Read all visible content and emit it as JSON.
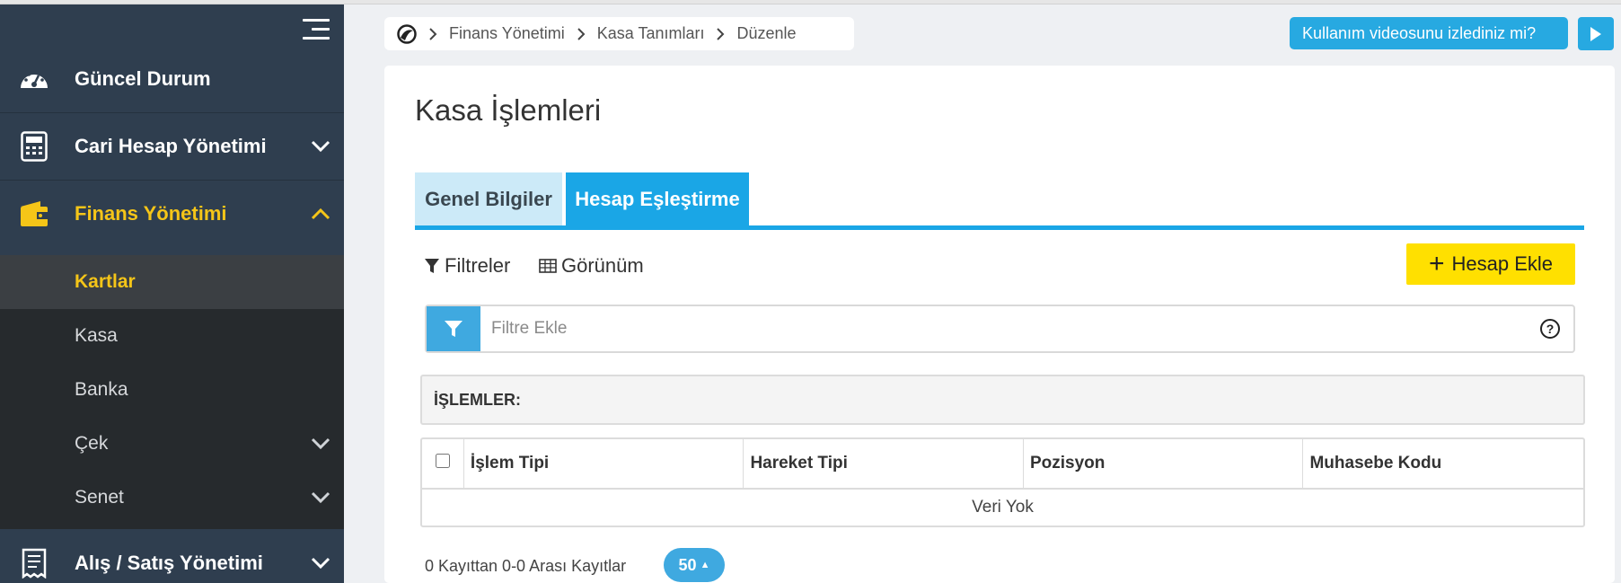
{
  "sidebar": {
    "items": [
      {
        "label": "Güncel Durum",
        "icon": "dashboard-gauge-icon"
      },
      {
        "label": "Cari Hesap Yönetimi",
        "icon": "calculator-icon"
      },
      {
        "label": "Finans Yönetimi",
        "icon": "wallet-icon"
      },
      {
        "label": "Alış / Satış Yönetimi",
        "icon": "receipt-icon"
      }
    ],
    "sub_items": [
      {
        "label": "Kartlar"
      },
      {
        "label": "Kasa"
      },
      {
        "label": "Banka"
      },
      {
        "label": "Çek"
      },
      {
        "label": "Senet"
      }
    ],
    "accent_color": "#f5c518"
  },
  "breadcrumb": {
    "items": [
      "Finans Yönetimi",
      "Kasa Tanımları",
      "Düzenle"
    ]
  },
  "help": {
    "video_label": "Kullanım videosunu izlediniz mi?"
  },
  "page": {
    "title": "Kasa İşlemleri",
    "tabs": [
      {
        "label": "Genel Bilgiler",
        "active": false
      },
      {
        "label": "Hesap Eşleştirme",
        "active": true
      }
    ]
  },
  "toolbar": {
    "filters_label": "Filtreler",
    "view_label": "Görünüm",
    "add_label": "Hesap Ekle"
  },
  "filter": {
    "placeholder": "Filtre Ekle"
  },
  "table": {
    "section_label": "İŞLEMLER:",
    "columns": [
      "İşlem Tipi",
      "Hareket Tipi",
      "Pozisyon",
      "Muhasebe Kodu"
    ],
    "empty_text": "Veri Yok"
  },
  "pager": {
    "summary": "0 Kayıttan 0-0 Arası Kayıtlar",
    "page_size": "50"
  },
  "colors": {
    "sidebar_bg": "#2f3e4f",
    "tab_active": "#1aa6e6",
    "add_button": "#ffe000"
  }
}
